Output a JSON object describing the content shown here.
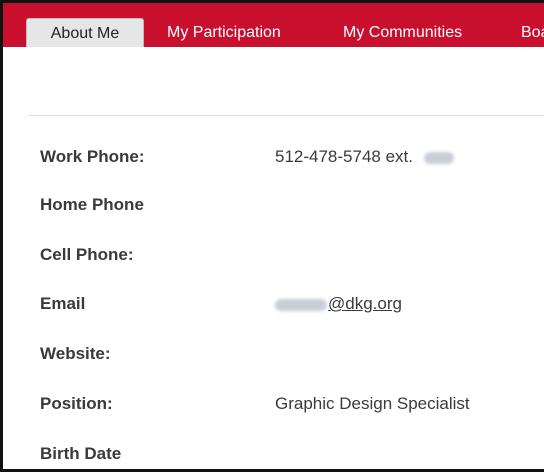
{
  "tabs": [
    {
      "label": "About Me",
      "active": true
    },
    {
      "label": "My Participation",
      "active": false
    },
    {
      "label": "My Communities",
      "active": false
    },
    {
      "label": "Boa",
      "active": false
    }
  ],
  "profile": {
    "work_phone": {
      "label": "Work Phone:",
      "value": "512-478-5748 ext."
    },
    "home_phone": {
      "label": "Home Phone",
      "value": ""
    },
    "cell_phone": {
      "label": "Cell Phone:",
      "value": ""
    },
    "email": {
      "label": "Email",
      "domain": "@dkg.org"
    },
    "website": {
      "label": "Website:",
      "value": ""
    },
    "position": {
      "label": "Position:",
      "value": "Graphic Design Specialist"
    },
    "birth_date": {
      "label": "Birth Date",
      "value": ""
    }
  },
  "colors": {
    "tab_bar": "#c8102e",
    "active_tab_bg": "#e6e6e6",
    "text": "#3a3a3a"
  }
}
